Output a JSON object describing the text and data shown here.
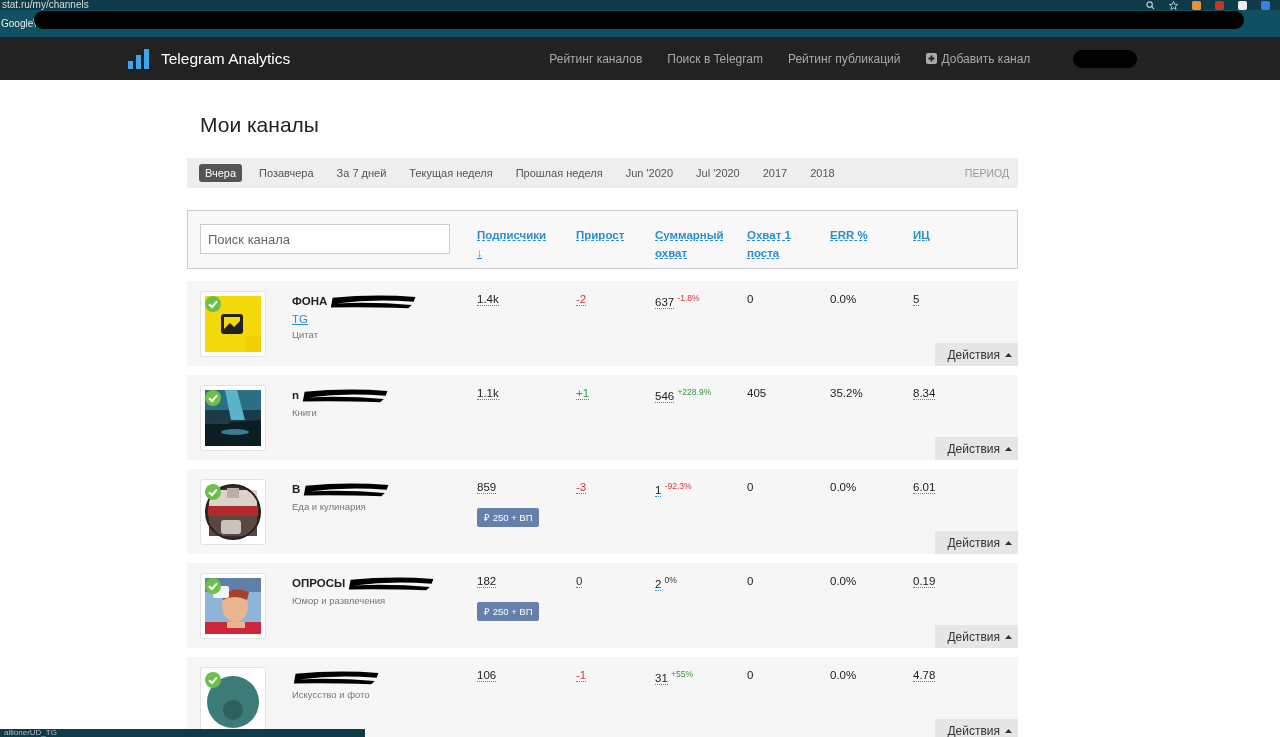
{
  "browser": {
    "url": "stat.ru/my/channels",
    "bookmark": "Google\\"
  },
  "nav": {
    "brand": "Telegram Analytics",
    "links": [
      {
        "label": "Рейтинг каналов",
        "kind": "link"
      },
      {
        "label": "Поиск в Telegram",
        "kind": "link"
      },
      {
        "label": "Рейтинг публикаций",
        "kind": "link"
      },
      {
        "label": "Добавить канал",
        "kind": "add"
      }
    ]
  },
  "page_title": "Мои каналы",
  "periods": [
    {
      "label": "Вчера",
      "selected": true
    },
    {
      "label": "Позавчера",
      "selected": false
    },
    {
      "label": "За 7 дней",
      "selected": false
    },
    {
      "label": "Текущая неделя",
      "selected": false
    },
    {
      "label": "Прошлая неделя",
      "selected": false
    },
    {
      "label": "Jun '2020",
      "selected": false
    },
    {
      "label": "Jul '2020",
      "selected": false
    },
    {
      "label": "2017",
      "selected": false
    },
    {
      "label": "2018",
      "selected": false
    }
  ],
  "period_label": "ПЕРИОД",
  "search": {
    "placeholder": "Поиск канала"
  },
  "columns": [
    {
      "label": "Подписчики ↓"
    },
    {
      "label": "Прирост"
    },
    {
      "label": "Суммарный охват"
    },
    {
      "label": "Охват 1 поста"
    },
    {
      "label": "ERR %"
    },
    {
      "label": "ИЦ"
    }
  ],
  "rows": [
    {
      "verified": true,
      "name": "ФОНА",
      "link": "TG",
      "category": "Цитат",
      "subscribers": "1.4k",
      "growth": {
        "text": "-2",
        "kind": "negative"
      },
      "reach": "637",
      "reach_change": {
        "text": "-1.8%",
        "kind": "negative"
      },
      "post_reach": "0",
      "err": "0.0%",
      "ic": "5",
      "action": "Действия"
    },
    {
      "verified": true,
      "name": "n",
      "category": "Книги",
      "subscribers": "1.1k",
      "growth": {
        "text": "+1",
        "kind": "positive"
      },
      "reach": "546",
      "reach_change": {
        "text": "+228.9%",
        "kind": "positive"
      },
      "post_reach": "405",
      "err": "35.2%",
      "ic": "8.34",
      "action": "Действия"
    },
    {
      "verified": true,
      "name": "В",
      "category": "Еда и кулинария",
      "subscribers": "859",
      "badge": "₽ 250 + ВП",
      "growth": {
        "text": "-3",
        "kind": "negative"
      },
      "reach": "1",
      "reach_change": {
        "text": "-92.3%",
        "kind": "negative"
      },
      "post_reach": "0",
      "err": "0.0%",
      "ic": "6.01",
      "action": "Действия"
    },
    {
      "verified": true,
      "name": "ОПРОСЫ",
      "category": "Юмор и развлечения",
      "subscribers": "182",
      "badge": "₽ 250 + ВП",
      "growth": {
        "text": "0",
        "kind": "neutral"
      },
      "reach": "2",
      "reach_change": {
        "text": "0%",
        "kind": "neutral"
      },
      "post_reach": "0",
      "err": "0.0%",
      "ic": "0.19",
      "action": "Действия"
    },
    {
      "verified": true,
      "category": "Искусство и фото",
      "subscribers": "106",
      "growth": {
        "text": "-1",
        "kind": "negative"
      },
      "reach": "31",
      "reach_change": {
        "text": "+55%",
        "kind": "positive"
      },
      "post_reach": "0",
      "err": "0.0%",
      "ic": "4.78",
      "action": "Действия"
    }
  ],
  "status_bar": {
    "text": "allionerUD_TG"
  }
}
